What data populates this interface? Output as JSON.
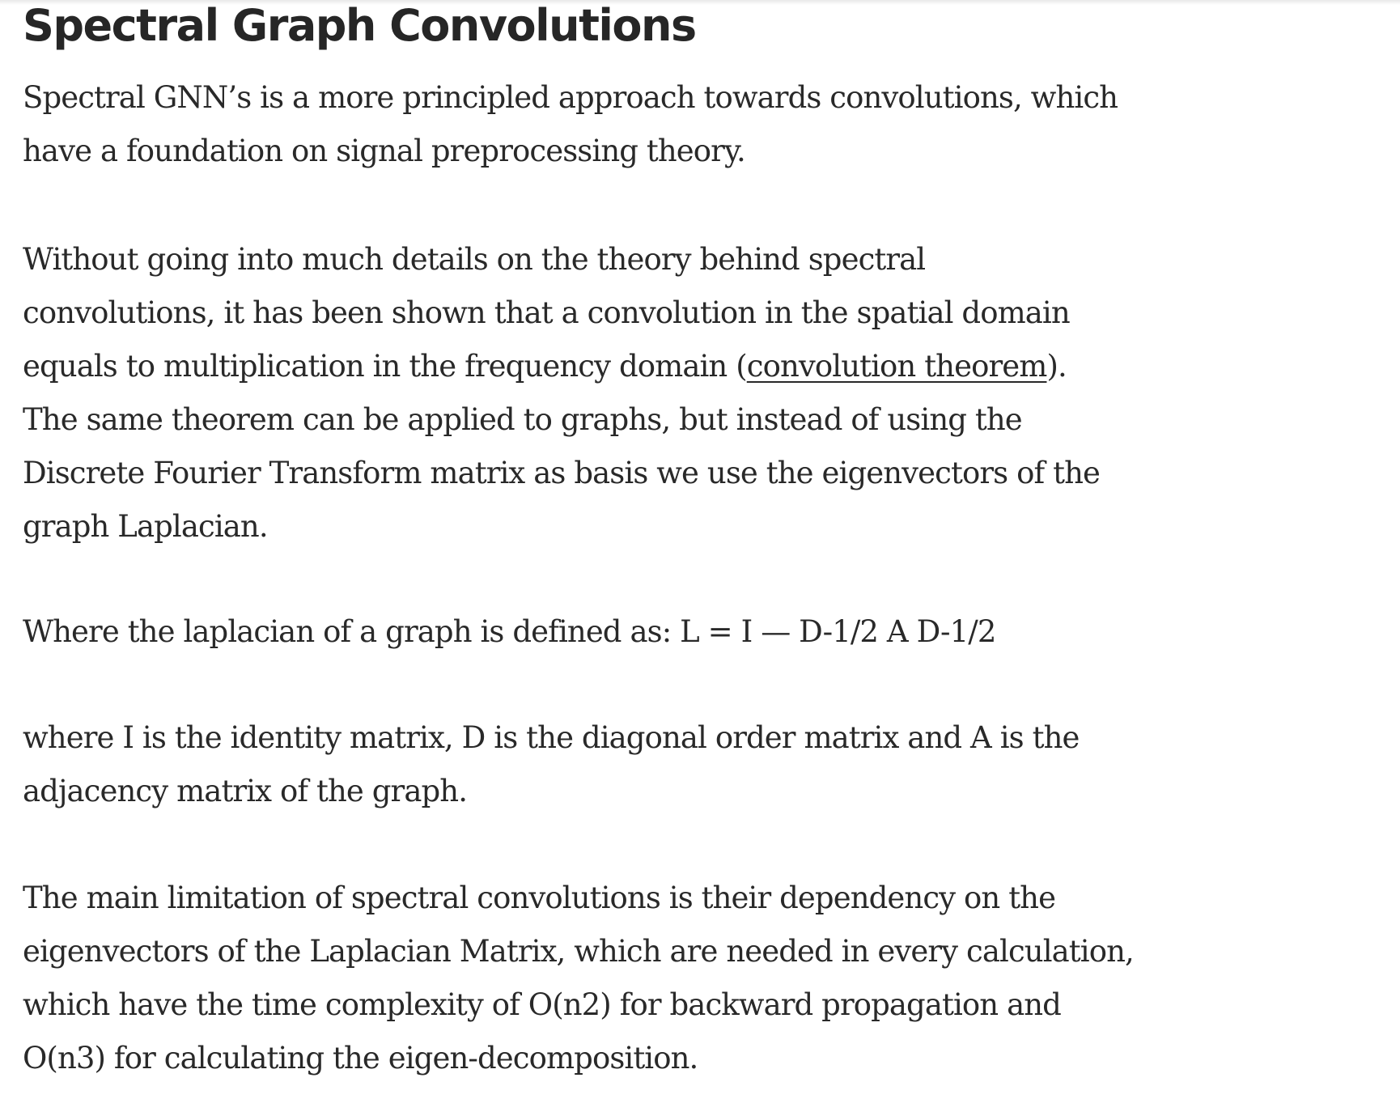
{
  "article": {
    "title": "Spectral Graph Convolutions",
    "paragraphs": {
      "p1": "Spectral GNN’s is a more principled approach towards convolutions, which\nhave a foundation on signal preprocessing theory.",
      "p2": {
        "before_link": "Without going into much details on the theory behind spectral\nconvolutions, it has been shown that a convolution in the spatial domain\nequals to multiplication in the frequency domain (",
        "link_text": "convolution theorem",
        "after_link": ").\nThe same theorem can be applied to graphs, but instead of using the\nDiscrete Fourier Transform matrix as basis we use the eigenvectors of the\ngraph Laplacian."
      },
      "p3": "Where the laplacian of a graph is defined as: L = I — D-1/2 A D-1/2",
      "p4": "where I is the identity matrix, D is the diagonal order matrix and A is the\nadjacency matrix of the graph.",
      "p5": "The main limitation of spectral convolutions is their dependency on the\neigenvectors of the Laplacian Matrix, which are needed in every calculation,\nwhich have the time complexity of O(n2) for backward propagation and\nO(n3) for calculating the eigen-decomposition."
    }
  }
}
